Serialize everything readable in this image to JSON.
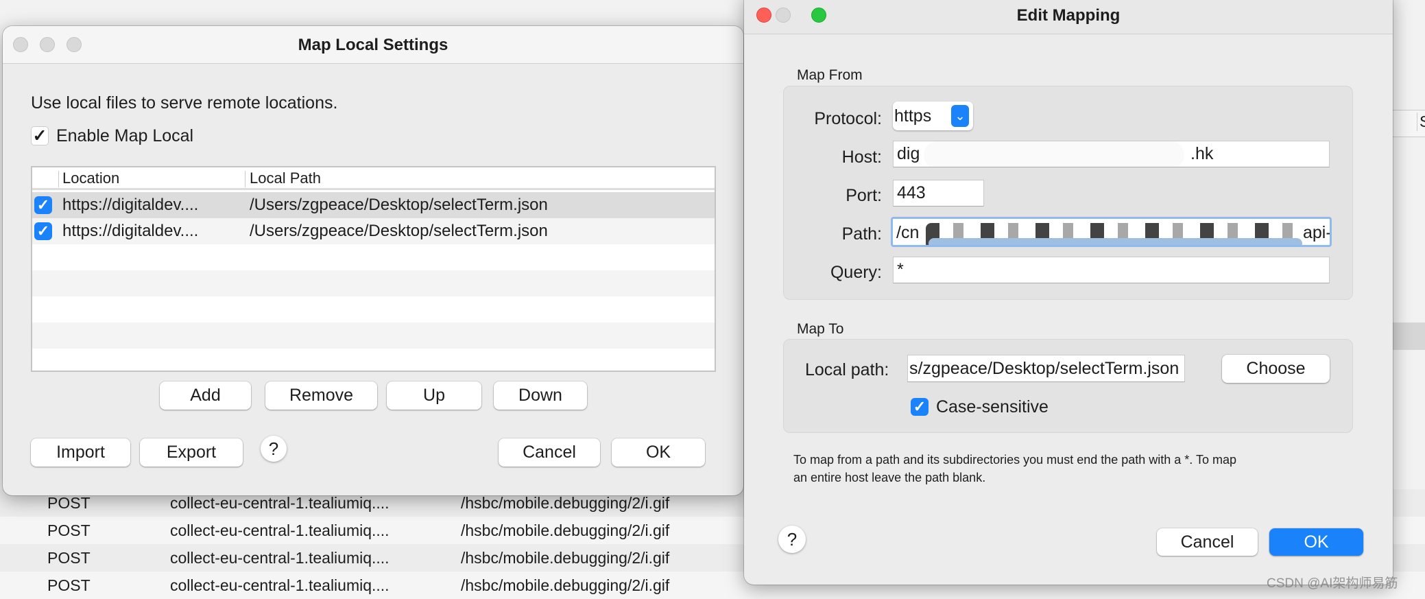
{
  "background": {
    "header_partial": "S",
    "rows": [
      {
        "method": "POST",
        "host": "collect-eu-central-1.tealiumiq....",
        "path": "/hsbc/mobile.debugging/2/i.gif"
      },
      {
        "method": "POST",
        "host": "collect-eu-central-1.tealiumiq....",
        "path": "/hsbc/mobile.debugging/2/i.gif"
      },
      {
        "method": "POST",
        "host": "collect-eu-central-1.tealiumiq....",
        "path": "/hsbc/mobile.debugging/2/i.gif"
      },
      {
        "method": "POST",
        "host": "collect-eu-central-1.tealiumiq....",
        "path": "/hsbc/mobile.debugging/2/i.gif"
      }
    ]
  },
  "map_local": {
    "title": "Map Local Settings",
    "description": "Use local files to serve remote locations.",
    "enable_label": "Enable Map Local",
    "enable_checked": true,
    "columns": [
      "Location",
      "Local Path"
    ],
    "rows": [
      {
        "checked": true,
        "location": "https://digitaldev....",
        "local_path": "/Users/zgpeace/Desktop/selectTerm.json"
      },
      {
        "checked": true,
        "location": "https://digitaldev....",
        "local_path": "/Users/zgpeace/Desktop/selectTerm.json"
      }
    ],
    "buttons": {
      "add": "Add",
      "remove": "Remove",
      "up": "Up",
      "down": "Down",
      "import": "Import",
      "export": "Export",
      "help": "?",
      "cancel": "Cancel",
      "ok": "OK"
    }
  },
  "edit_mapping": {
    "title": "Edit Mapping",
    "map_from": {
      "heading": "Map From",
      "protocol_label": "Protocol:",
      "protocol_value": "https",
      "host_label": "Host:",
      "host_value_start": "dig",
      "host_value_end": ".hk",
      "port_label": "Port:",
      "port_value": "443",
      "path_label": "Path:",
      "path_value_start": "/cn",
      "path_value_end": "api-",
      "query_label": "Query:",
      "query_value": "*"
    },
    "map_to": {
      "heading": "Map To",
      "local_path_label": "Local path:",
      "local_path_value": "s/zgpeace/Desktop/selectTerm.json",
      "choose": "Choose",
      "case_sensitive_label": "Case-sensitive",
      "case_sensitive_checked": true
    },
    "hint_line1": "To map from a path and its subdirectories you must end the path with a *. To map",
    "hint_line2": "an entire host leave the path blank.",
    "buttons": {
      "help": "?",
      "cancel": "Cancel",
      "ok": "OK"
    }
  },
  "watermark": "CSDN @AI架构师易筋",
  "colors": {
    "accent": "#1a82fb",
    "close": "#fe5f57",
    "zoom": "#28c840"
  }
}
